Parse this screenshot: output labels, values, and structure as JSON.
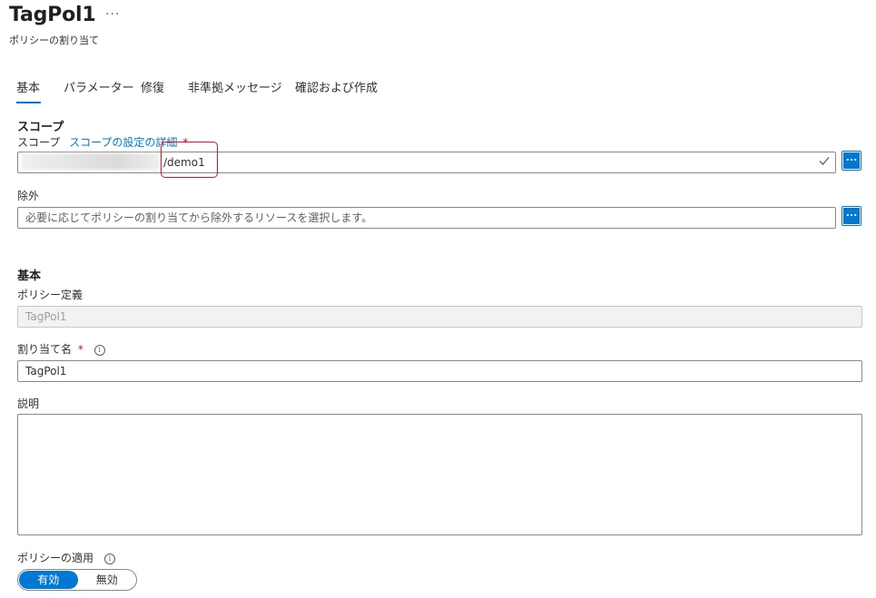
{
  "header": {
    "title": "TagPol1",
    "more": "···",
    "subtitle": "ポリシーの割り当て"
  },
  "tabs": [
    {
      "label": "基本",
      "active": true
    },
    {
      "label": "パラメーター",
      "active": false
    },
    {
      "label": "修復",
      "active": false
    },
    {
      "label": "非準拠メッセージ",
      "active": false
    },
    {
      "label": "確認および作成",
      "active": false
    }
  ],
  "scope_section": {
    "heading": "スコープ",
    "scope_label": "スコープ",
    "scope_link": "スコープの設定の詳細",
    "required_mark": "*",
    "scope_value": "/demo1",
    "browse_label": "...",
    "exclusion_label": "除外",
    "exclusion_placeholder": "必要に応じてポリシーの割り当てから除外するリソースを選択します。"
  },
  "basics_section": {
    "heading": "基本",
    "policy_definition_label": "ポリシー定義",
    "policy_definition_value": "TagPol1",
    "assignment_name_label": "割り当て名",
    "required_mark": "*",
    "info_glyph": "i",
    "assignment_name_value": "TagPol1",
    "description_label": "説明",
    "description_value": "",
    "enforcement_label": "ポリシーの適用",
    "enforcement_options": [
      "有効",
      "無効"
    ],
    "enforcement_selected": "有効"
  },
  "colors": {
    "accent": "#0078d4",
    "highlight_box": "#e81123",
    "required": "#a4262c"
  }
}
